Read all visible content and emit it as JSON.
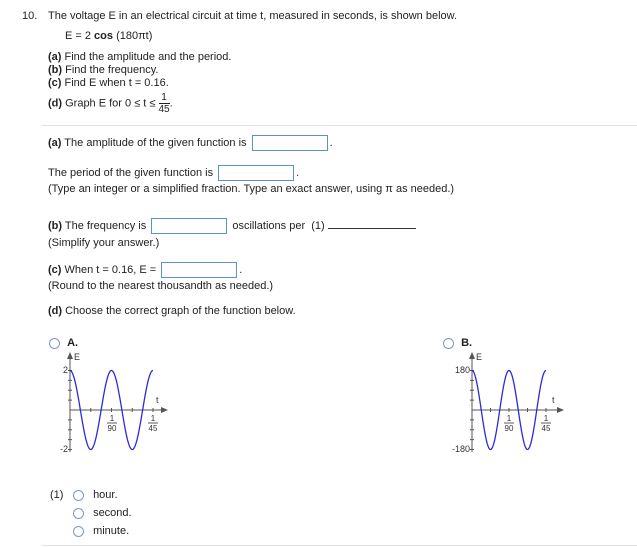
{
  "question": {
    "number": "10.",
    "prompt": "The voltage E in an electrical circuit at time t, measured in seconds, is shown below.",
    "equation_prefix": "E = 2 ",
    "equation_func": "cos",
    "equation_arg": " (180πt)",
    "parts": [
      {
        "label": "(a)",
        "text": " Find the amplitude and the period."
      },
      {
        "label": "(b)",
        "text": " Find the frequency."
      },
      {
        "label": "(c)",
        "text": " Find E when t = 0.16."
      },
      {
        "label": "(d)",
        "text": " Graph E for 0 ≤ t ≤ ",
        "frac_num": "1",
        "frac_den": "45",
        "suffix": "."
      }
    ]
  },
  "answers": {
    "a_label": "(a)",
    "a_amplitude_text": " The amplitude of the given function is",
    "a_amplitude_value": "",
    "a_period_text": "The period of the given function is",
    "a_period_value": "",
    "a_hint": "(Type an integer or a simplified fraction. Type an exact answer, using π as needed.)",
    "b_label": "(b)",
    "b_text": " The frequency is",
    "b_value": "",
    "b_units": "oscillations per",
    "b_blank_label": "(1)",
    "b_hint": "(Simplify your answer.)",
    "c_label": "(c)",
    "c_text": " When t = 0.16, E =",
    "c_value": "",
    "c_hint": "(Round to the nearest thousandth as needed.)",
    "d_label": "(d)",
    "d_text": " Choose the correct graph of the function below."
  },
  "graph_options": [
    {
      "letter": "A.",
      "y_label": "E",
      "x_label": "t",
      "y_max_label": "2",
      "y_min_label": "-2",
      "x_tick1_num": "1",
      "x_tick1_den": "90",
      "x_tick2_num": "1",
      "x_tick2_den": "45",
      "amplitude": 2,
      "angular_freq": "180π",
      "t_max": "1/45",
      "selected": false
    },
    {
      "letter": "B.",
      "y_label": "E",
      "x_label": "t",
      "y_max_label": "180",
      "y_min_label": "-180",
      "x_tick1_num": "1",
      "x_tick1_den": "90",
      "x_tick2_num": "1",
      "x_tick2_den": "45",
      "amplitude": 180,
      "angular_freq": "180π",
      "t_max": "1/45",
      "selected": false
    }
  ],
  "unit_choices": {
    "label": "(1)",
    "options": [
      "hour.",
      "second.",
      "minute."
    ]
  },
  "colors": {
    "curve": "#2b2bdc",
    "input_border": "#5b8fd6",
    "radio_border": "#7f94d1"
  }
}
